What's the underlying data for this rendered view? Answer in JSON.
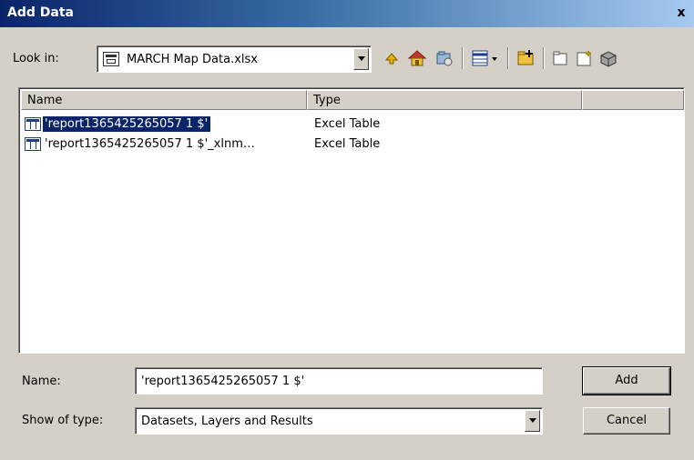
{
  "window": {
    "title": "Add Data",
    "close_glyph": "x"
  },
  "look_in": {
    "label": "Look in:",
    "value": "MARCH Map Data.xlsx",
    "icon": "excel-workbook-icon"
  },
  "toolbar": {
    "buttons": [
      {
        "name": "up-one-level-icon"
      },
      {
        "name": "home-icon"
      },
      {
        "name": "connect-folder-icon"
      },
      {
        "name": "view-list-icon"
      },
      {
        "name": "new-folder-icon"
      },
      {
        "name": "new-item-icon"
      },
      {
        "name": "new-table-icon"
      },
      {
        "name": "geodatabase-icon"
      }
    ]
  },
  "list": {
    "columns": [
      "Name",
      "Type"
    ],
    "rows": [
      {
        "name": "'report1365425265057 1 $'",
        "type": "Excel Table",
        "selected": true,
        "icon": "table-icon"
      },
      {
        "name": "'report1365425265057 1 $'_xlnm…",
        "type": "Excel Table",
        "selected": false,
        "icon": "table-icon"
      }
    ]
  },
  "name_field": {
    "label": "Name:",
    "value": "'report1365425265057 1 $'"
  },
  "type_field": {
    "label": "Show of type:",
    "value": "Datasets, Layers and Results"
  },
  "buttons": {
    "add": "Add",
    "cancel": "Cancel"
  }
}
